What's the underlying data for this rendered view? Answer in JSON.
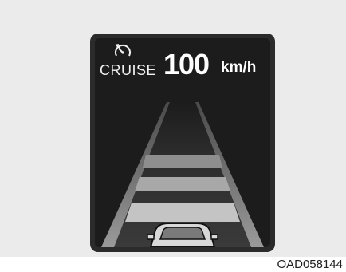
{
  "cluster": {
    "mode_label": "CRUISE",
    "set_speed": "100",
    "speed_unit": "km/h"
  },
  "icons": {
    "cruise": "cruise-control-icon",
    "vehicle": "own-vehicle-icon"
  },
  "caption": "OAD058144",
  "colors": {
    "background": "#ebebeb",
    "screen": "#1c1c1c",
    "text": "#ffffff"
  }
}
